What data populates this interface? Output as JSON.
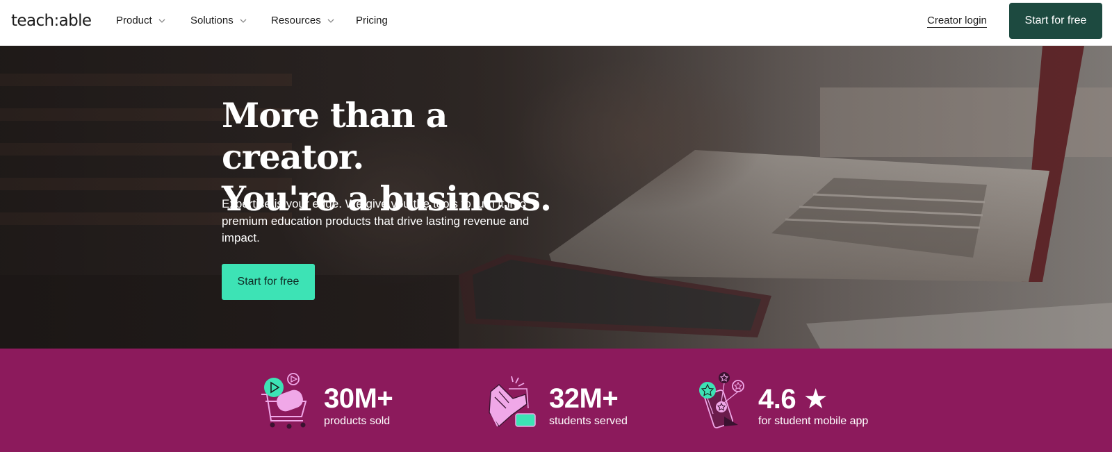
{
  "brand": {
    "logo_text": "teach:able"
  },
  "nav": {
    "items": [
      {
        "label": "Product",
        "has_dropdown": true
      },
      {
        "label": "Solutions",
        "has_dropdown": true
      },
      {
        "label": "Resources",
        "has_dropdown": true
      },
      {
        "label": "Pricing",
        "has_dropdown": false
      }
    ],
    "login_label": "Creator login",
    "cta_label": "Start for free"
  },
  "hero": {
    "title_line1": "More than a creator.",
    "title_line2": "You're a business.",
    "body": "Expertise is your edge. We give you the tools to turn it into premium education products that drive lasting revenue and impact.",
    "cta_label": "Start for free"
  },
  "stats": [
    {
      "value": "30M+",
      "label": "products sold",
      "icon": "shopping-cart-illustration-icon"
    },
    {
      "value": "32M+",
      "label": "students served",
      "icon": "clapping-hands-illustration-icon"
    },
    {
      "value": "4.6 ★",
      "label": "for student mobile app",
      "icon": "phone-stars-illustration-icon"
    }
  ],
  "colors": {
    "nav_cta_bg": "#1d4a40",
    "hero_cta_bg": "#3de3b5",
    "stats_bg": "#8c1a5c",
    "accent_pink": "#f0a8e8"
  }
}
